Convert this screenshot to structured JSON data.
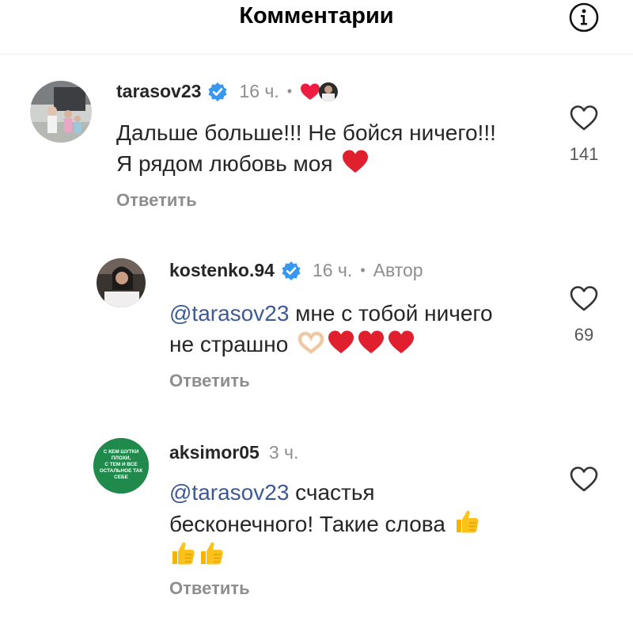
{
  "header": {
    "title": "Комментарии",
    "info_icon": "info-icon"
  },
  "comments": [
    {
      "username": "tarasov23",
      "verified": true,
      "time": "16 ч.",
      "lines": [
        "Дальше больше!!! Не бойся ничего!!!",
        "Я рядом любовь моя"
      ],
      "reply_label": "Ответить",
      "likes": "141",
      "creator_liked": true
    },
    {
      "username": "kostenko.94",
      "verified": true,
      "time": "16 ч.",
      "author_label": "Автор",
      "mention": "@tarasov23",
      "lines": [
        " мне с тобой ничего",
        "не страшно"
      ],
      "reply_label": "Ответить",
      "likes": "69"
    },
    {
      "username": "aksimor05",
      "verified": false,
      "time": "3 ч.",
      "mention": "@tarasov23",
      "lines": [
        " счастья",
        "бесконечного! Такие слова"
      ],
      "reply_label": "Ответить",
      "avatar_text": [
        "С КЕМ ШУТКИ",
        "ПЛОХИ,",
        "С ТЕМ И ВСЕ",
        "ОСТАЛЬНОЕ ТАК",
        "СЕБЕ"
      ]
    }
  ]
}
